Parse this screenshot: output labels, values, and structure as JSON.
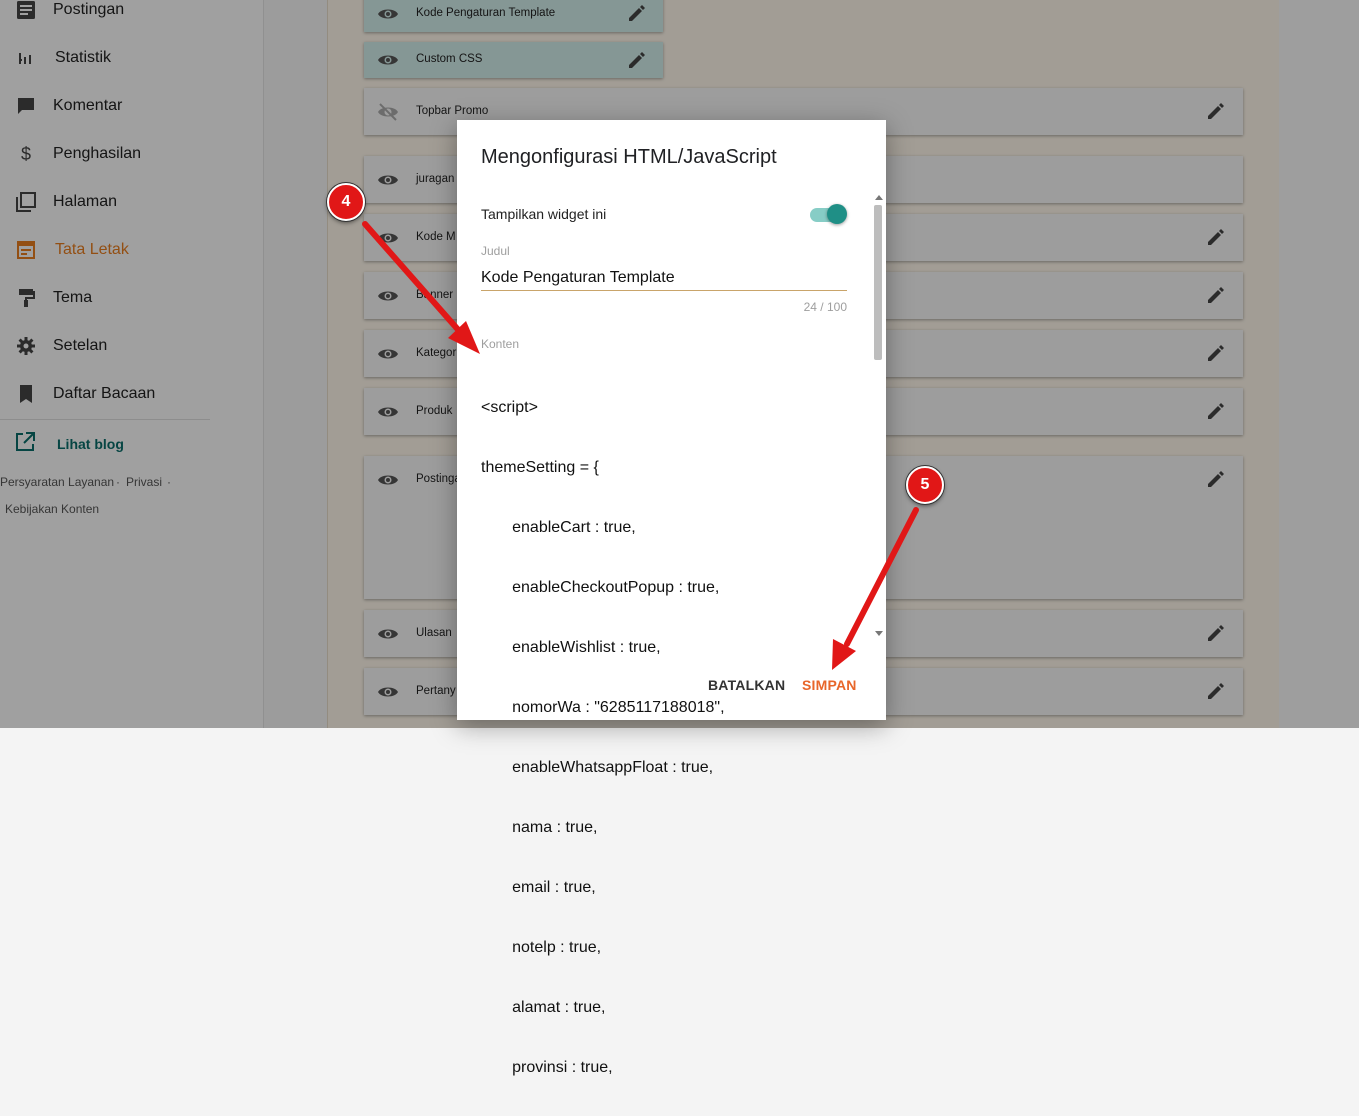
{
  "sidebar": {
    "items": [
      {
        "label": "Postingan",
        "icon": "posts-icon"
      },
      {
        "label": "Statistik",
        "icon": "stats-icon"
      },
      {
        "label": "Komentar",
        "icon": "comment-icon"
      },
      {
        "label": "Penghasilan",
        "icon": "dollar-icon"
      },
      {
        "label": "Halaman",
        "icon": "pages-icon"
      },
      {
        "label": "Tata Letak",
        "icon": "layout-icon",
        "active": true
      },
      {
        "label": "Tema",
        "icon": "paint-roller-icon"
      },
      {
        "label": "Setelan",
        "icon": "gear-icon"
      },
      {
        "label": "Daftar Bacaan",
        "icon": "bookmark-icon"
      }
    ],
    "view_blog": "Lihat blog",
    "footer": {
      "terms": "Persyaratan Layanan",
      "sep1": "·",
      "privacy": "Privasi",
      "sep2": "·",
      "content_policy": "Kebijakan Konten"
    }
  },
  "layout": {
    "widgets": [
      {
        "label": "Kode Pengaturan Template",
        "visible": true
      },
      {
        "label": "Custom CSS",
        "visible": true
      },
      {
        "label": "Topbar Promo",
        "visible": false
      },
      {
        "label": "juragan",
        "visible": true
      },
      {
        "label": "Kode M",
        "visible": true
      },
      {
        "label": "Banner",
        "visible": true
      },
      {
        "label": "Kategor",
        "visible": true
      },
      {
        "label": "Produk",
        "visible": true
      },
      {
        "label": "Postinga",
        "visible": true
      },
      {
        "label": "Ulasan",
        "visible": true
      },
      {
        "label": "Pertany",
        "visible": true
      }
    ]
  },
  "dialog": {
    "title": "Mengonfigurasi HTML/JavaScript",
    "show_widget_label": "Tampilkan widget ini",
    "show_widget_on": true,
    "title_field_label": "Judul",
    "title_field_value": "Kode Pengaturan Template",
    "title_counter": "24 / 100",
    "content_label": "Konten",
    "content_lines": [
      "<script>",
      "themeSetting = {",
      "       enableCart : true,",
      "       enableCheckoutPopup : true,",
      "       enableWishlist : true,",
      "       nomorWa : \"6285117188018\",",
      "       enableWhatsappFloat : true,",
      "       nama : true,",
      "       email : true,",
      "       notelp : true,",
      "       alamat : true,",
      "       provinsi : true,"
    ],
    "cancel_label": "BATALKAN",
    "save_label": "SIMPAN"
  },
  "annotations": {
    "step4": "4",
    "step5": "5",
    "color": "#e11717"
  },
  "colors": {
    "accent_orange": "#e67c1f",
    "teal": "#1f8f86",
    "save_orange": "#e8662a"
  }
}
